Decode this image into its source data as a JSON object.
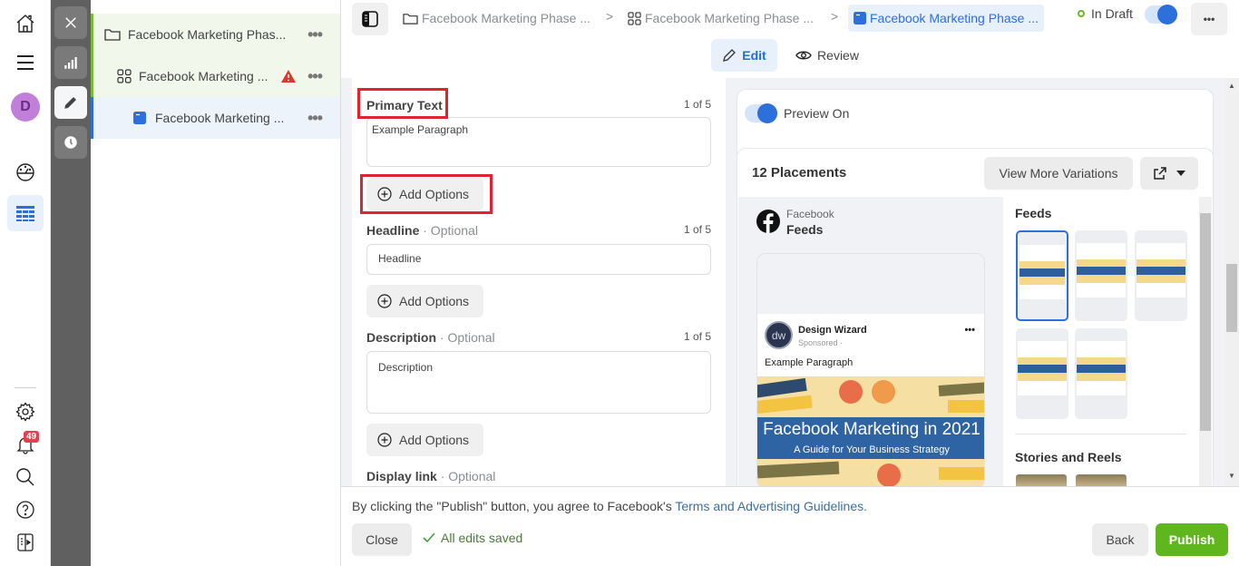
{
  "rail": {
    "avatar_initial": "D",
    "notification_count": "49",
    "icons": [
      "home-icon",
      "menu-icon",
      "avatar",
      "dashboard-gauge-icon",
      "table-grid-icon",
      "settings-gear-icon",
      "bell-icon",
      "search-icon",
      "help-icon",
      "panel-toggle-icon"
    ]
  },
  "strip": {
    "icons": [
      "close-icon",
      "bar-chart-icon",
      "pencil-icon",
      "clock-icon"
    ],
    "active": "pencil-icon"
  },
  "tree": {
    "items": [
      {
        "label": "Facebook Marketing Phas...",
        "icon": "folder-icon",
        "warning": false
      },
      {
        "label": "Facebook Marketing ...",
        "icon": "grid-icon",
        "warning": true
      },
      {
        "label": "Facebook Marketing ...",
        "icon": "ad-icon",
        "warning": false
      }
    ],
    "more_glyph": "•••"
  },
  "topbar": {
    "breadcrumbs": [
      {
        "label": "Facebook Marketing Phase ...",
        "icon": "folder-icon"
      },
      {
        "label": "Facebook Marketing Phase ...",
        "icon": "grid-icon"
      },
      {
        "label": "Facebook Marketing Phase ...",
        "icon": "ad-icon",
        "active": true
      }
    ],
    "separator": ">",
    "status": "In Draft",
    "status_color": "#6ab42d",
    "more_glyph": "•••"
  },
  "modes": {
    "edit_label": "Edit",
    "review_label": "Review"
  },
  "form": {
    "primary_text": {
      "label": "Primary Text",
      "count": "1 of 5",
      "value": "Example Paragraph"
    },
    "headline": {
      "label": "Headline",
      "optional": " · Optional",
      "count": "1 of 5",
      "placeholder": "Headline"
    },
    "description": {
      "label": "Description",
      "optional": " · Optional",
      "count": "1 of 5",
      "placeholder": "Description"
    },
    "display_link": {
      "label": "Display link",
      "optional": " · Optional"
    },
    "add_options_label": "Add Options"
  },
  "preview": {
    "toggle_label": "Preview On",
    "placements_title": "12 Placements",
    "view_more_label": "View More Variations",
    "platform": "Facebook",
    "placement": "Feeds",
    "page_name": "Design Wizard",
    "sponsored": "Sponsored · ",
    "post_text": "Example Paragraph",
    "image_title": "Facebook Marketing in 2021",
    "image_subtitle": "A Guide for Your Business Strategy",
    "avatar_text": "dw",
    "more_glyph": "•••",
    "feeds_heading": "Feeds",
    "stories_heading": "Stories and Reels",
    "feed_thumbnail_count": 5
  },
  "footer": {
    "notice_prefix": "By clicking the \"Publish\" button, you agree to Facebook's ",
    "notice_link": "Terms and Advertising Guidelines.",
    "close_label": "Close",
    "saved_status": "All edits saved",
    "back_label": "Back",
    "publish_label": "Publish",
    "publish_color": "#5fb61e"
  }
}
